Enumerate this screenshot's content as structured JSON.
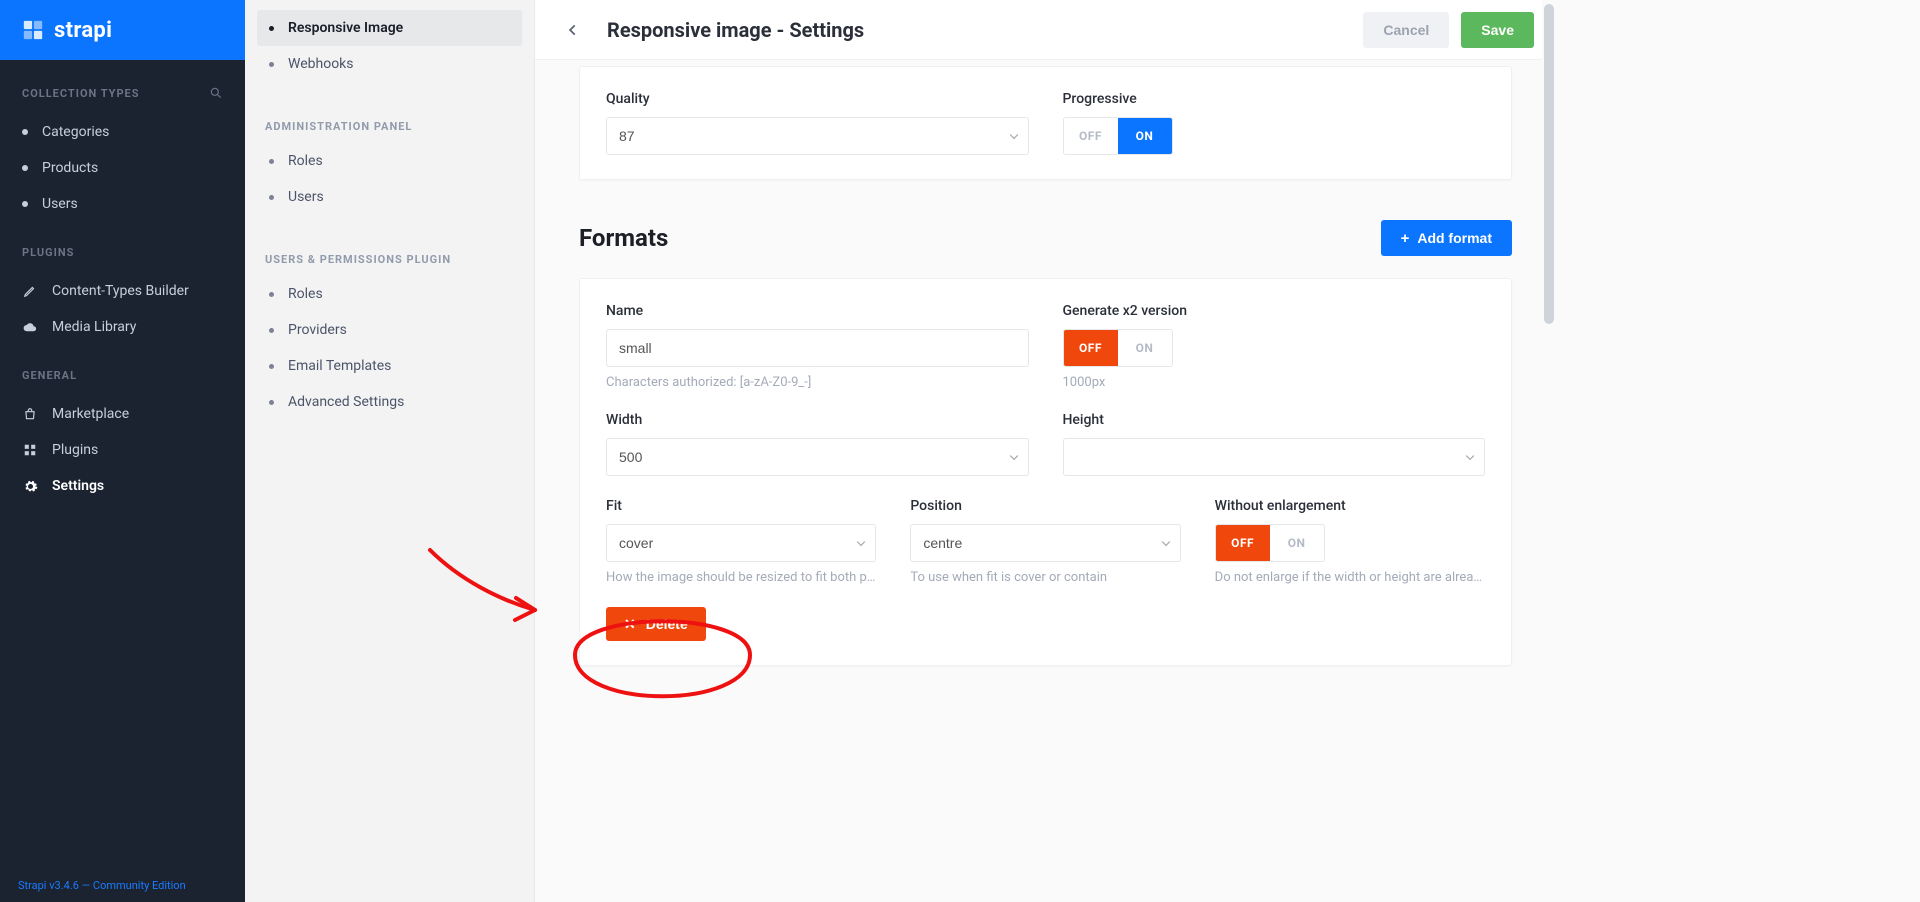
{
  "brand": "strapi",
  "version": "Strapi v3.4.6 — Community Edition",
  "sidebar": {
    "sections": [
      {
        "heading": "COLLECTION TYPES",
        "searchable": true,
        "items": [
          {
            "label": "Categories",
            "kind": "dot"
          },
          {
            "label": "Products",
            "kind": "dot"
          },
          {
            "label": "Users",
            "kind": "dot"
          }
        ]
      },
      {
        "heading": "PLUGINS",
        "items": [
          {
            "label": "Content-Types Builder",
            "icon": "pencil-icon"
          },
          {
            "label": "Media Library",
            "icon": "cloud-icon"
          }
        ]
      },
      {
        "heading": "GENERAL",
        "items": [
          {
            "label": "Marketplace",
            "icon": "bag-icon"
          },
          {
            "label": "Plugins",
            "icon": "grid-icon"
          },
          {
            "label": "Settings",
            "icon": "gear-icon",
            "active": true
          }
        ]
      }
    ]
  },
  "subnav": {
    "sections": [
      {
        "items": [
          {
            "label": "Responsive Image",
            "active": true
          },
          {
            "label": "Webhooks"
          }
        ]
      },
      {
        "heading": "ADMINISTRATION PANEL",
        "items": [
          {
            "label": "Roles"
          },
          {
            "label": "Users"
          }
        ]
      },
      {
        "heading": "USERS & PERMISSIONS PLUGIN",
        "items": [
          {
            "label": "Roles"
          },
          {
            "label": "Providers"
          },
          {
            "label": "Email Templates"
          },
          {
            "label": "Advanced Settings"
          }
        ]
      }
    ]
  },
  "top": {
    "title": "Responsive image - Settings",
    "cancel": "Cancel",
    "save": "Save"
  },
  "global": {
    "quality": {
      "label": "Quality",
      "value": "87"
    },
    "progressive": {
      "label": "Progressive",
      "off": "OFF",
      "on": "ON",
      "state": "on"
    }
  },
  "formats": {
    "heading": "Formats",
    "add": "Add format",
    "entries": [
      {
        "name": {
          "label": "Name",
          "value": "small",
          "help": "Characters authorized: [a-zA-Z0-9_-]"
        },
        "gen2x": {
          "label": "Generate x2 version",
          "off": "OFF",
          "on": "ON",
          "state": "off",
          "help": "1000px"
        },
        "width": {
          "label": "Width",
          "value": "500"
        },
        "height": {
          "label": "Height",
          "value": ""
        },
        "fit": {
          "label": "Fit",
          "value": "cover",
          "help": "How the image should be resized to fit both pr…"
        },
        "position": {
          "label": "Position",
          "value": "centre",
          "help": "To use when fit is cover or contain"
        },
        "without": {
          "label": "Without enlargement",
          "off": "OFF",
          "on": "ON",
          "state": "off",
          "help": "Do not enlarge if the width or height are alread…"
        },
        "delete": "Delete"
      }
    ]
  }
}
